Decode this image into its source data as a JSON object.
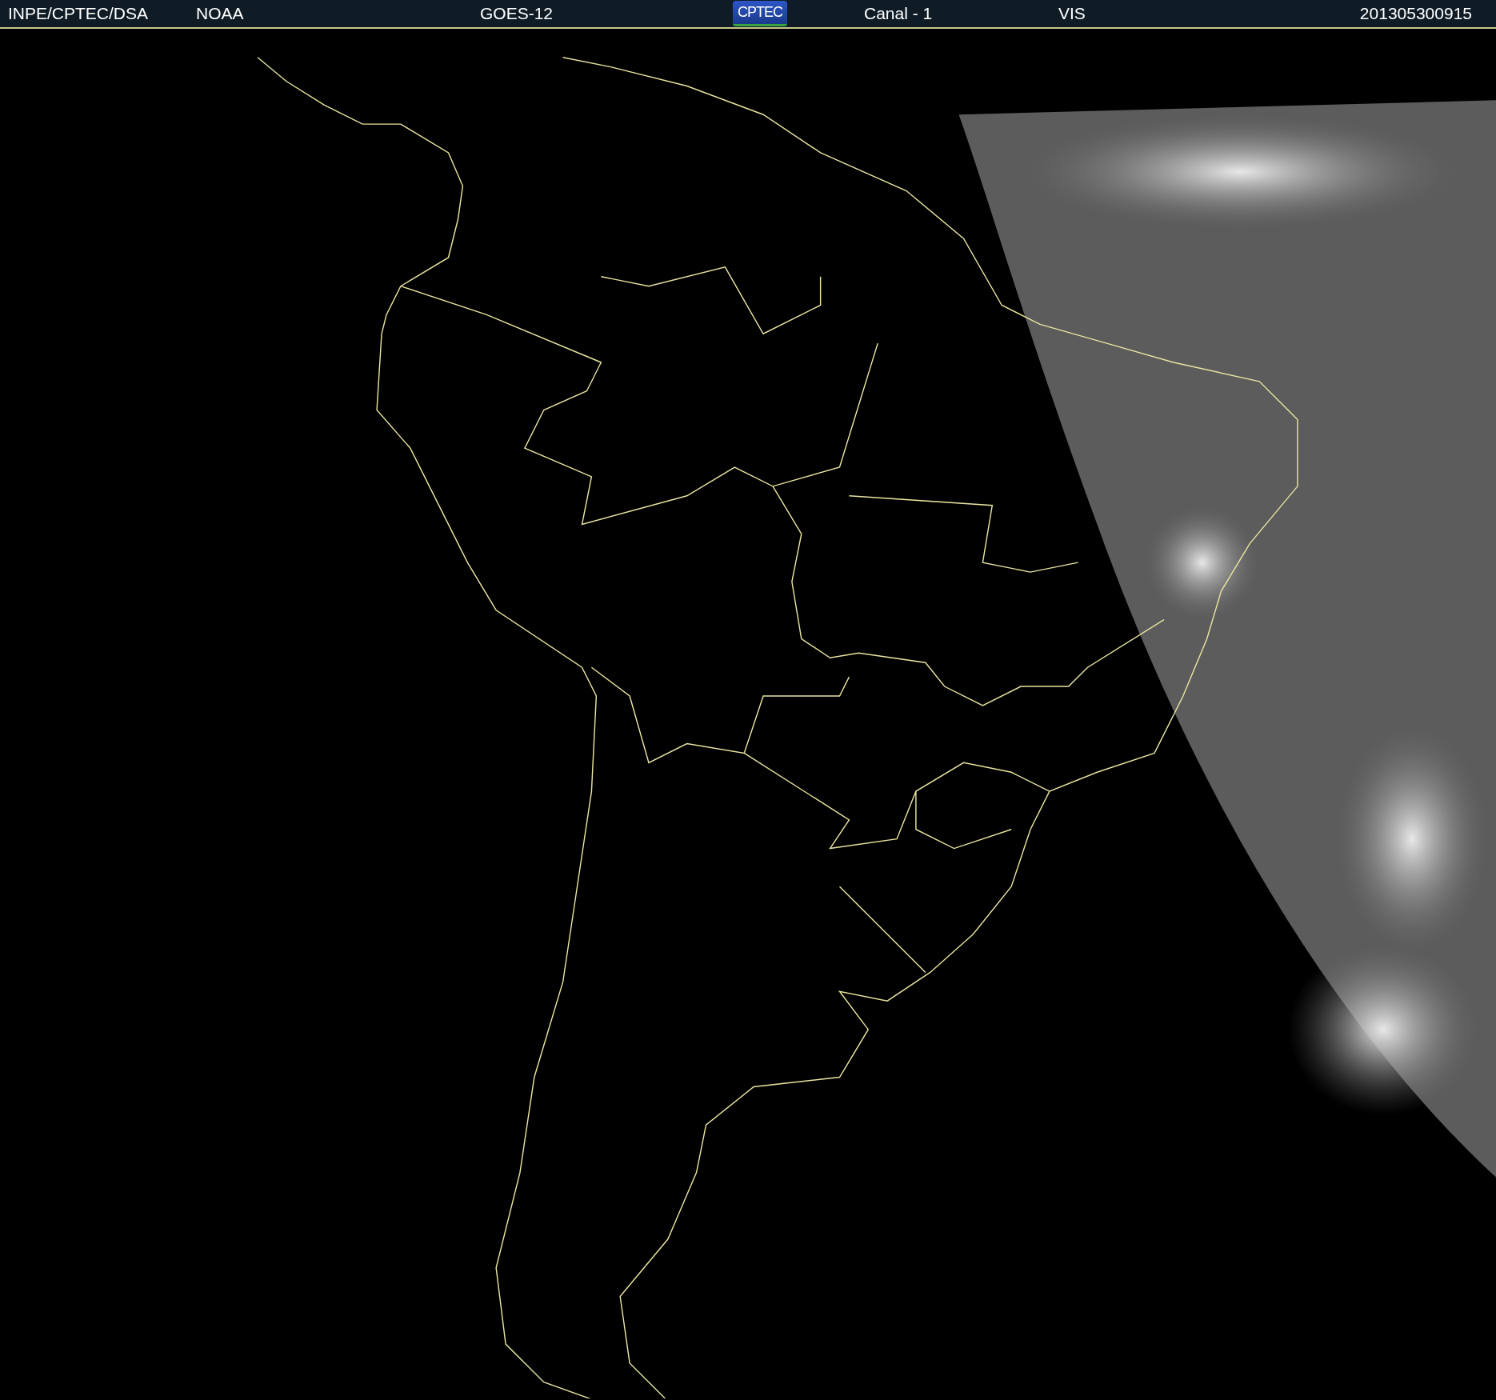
{
  "header": {
    "items": [
      {
        "kind": "text",
        "label": "INPE/CPTEC/DSA"
      },
      {
        "kind": "text",
        "label": "NOAA"
      },
      {
        "kind": "text",
        "label": "GOES-12"
      },
      {
        "kind": "logo",
        "label": "CPTEC"
      },
      {
        "kind": "text",
        "label": "Canal - 1"
      },
      {
        "kind": "text",
        "label": "VIS"
      },
      {
        "kind": "text",
        "label": "201305300915"
      }
    ]
  }
}
